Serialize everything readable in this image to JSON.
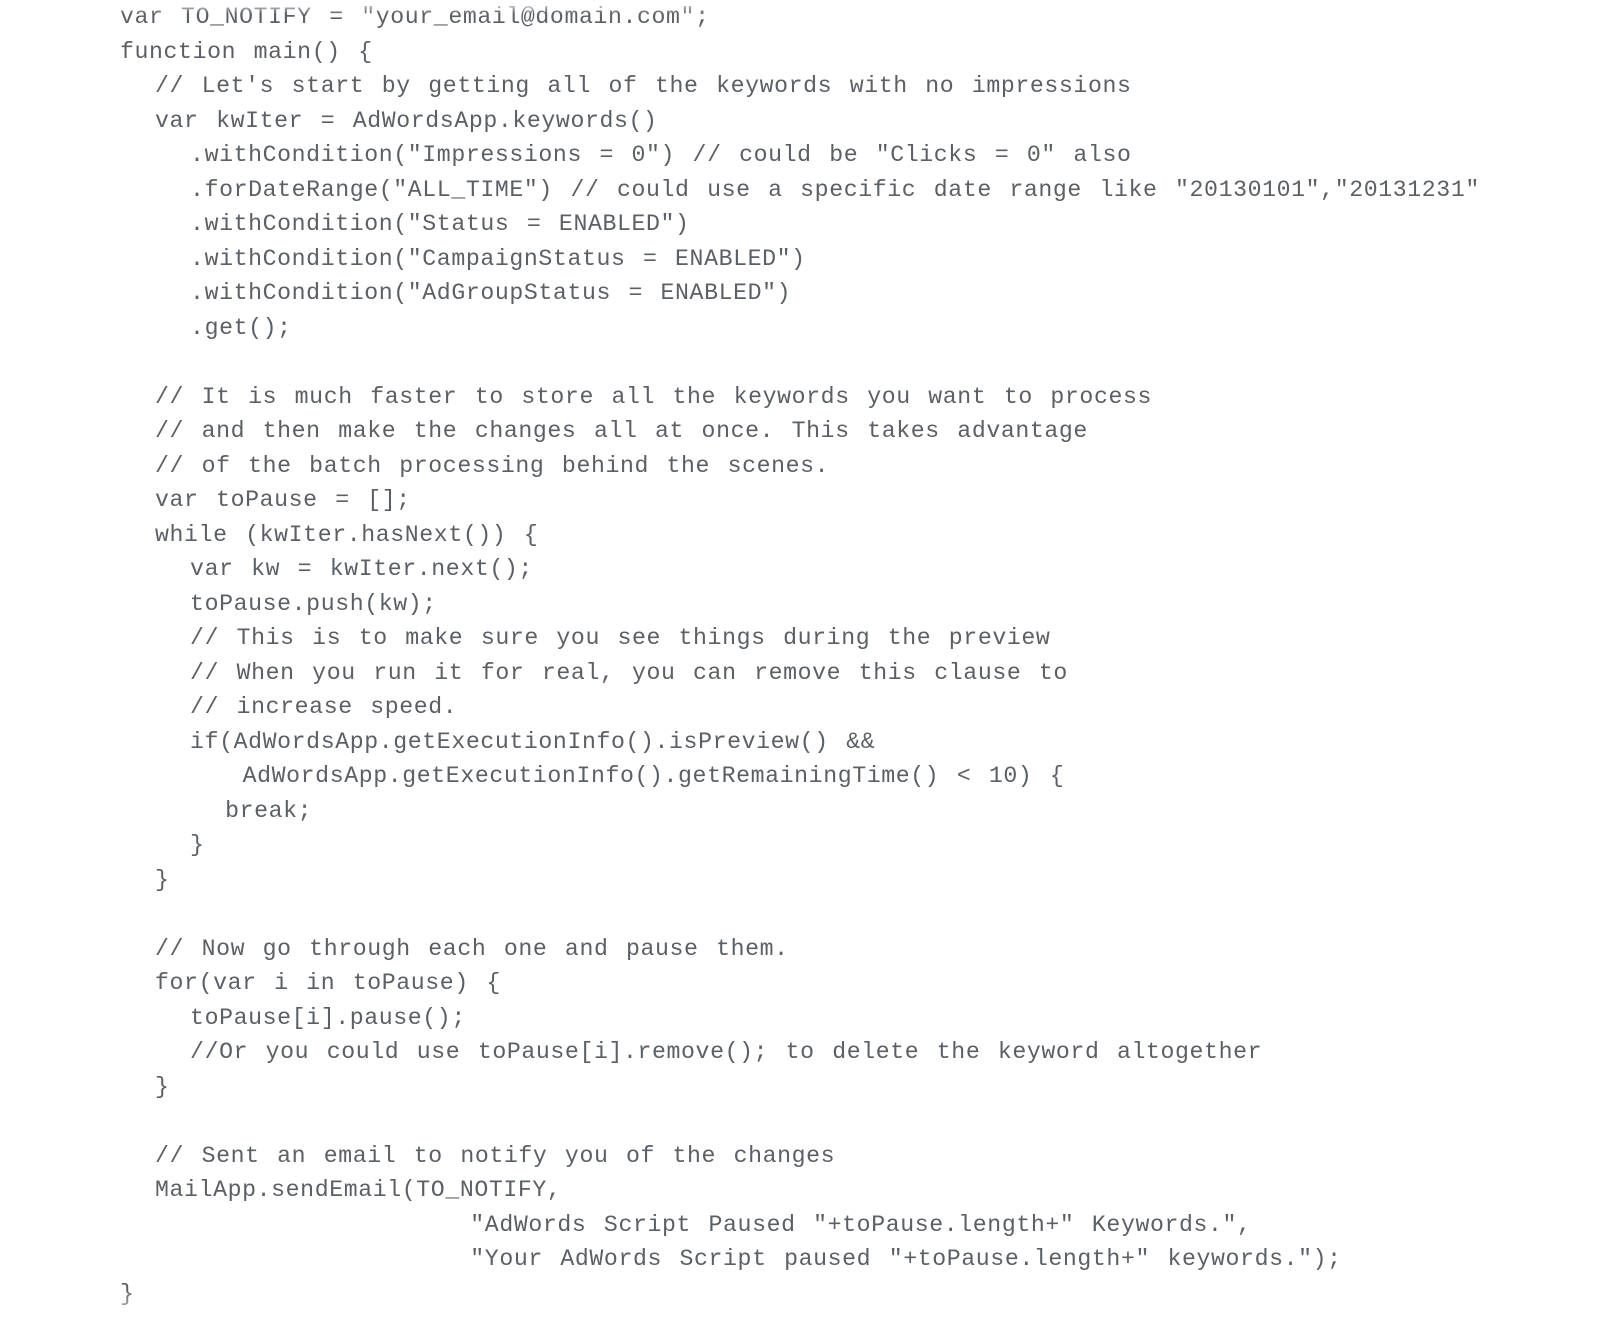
{
  "code": {
    "lines": [
      "var TO_NOTIFY = \"your_email@domain.com\";",
      "function main() {",
      "  // Let's start by getting all of the keywords with no impressions",
      "  var kwIter = AdWordsApp.keywords()",
      "    .withCondition(\"Impressions = 0\") // could be \"Clicks = 0\" also",
      "    .forDateRange(\"ALL_TIME\") // could use a specific date range like \"20130101\",\"20131231\"",
      "    .withCondition(\"Status = ENABLED\")",
      "    .withCondition(\"CampaignStatus = ENABLED\")",
      "    .withCondition(\"AdGroupStatus = ENABLED\")",
      "    .get();",
      " ",
      "  // It is much faster to store all the keywords you want to process",
      "  // and then make the changes all at once. This takes advantage",
      "  // of the batch processing behind the scenes.",
      "  var toPause = [];",
      "  while (kwIter.hasNext()) {",
      "    var kw = kwIter.next();",
      "    toPause.push(kw);",
      "    // This is to make sure you see things during the preview",
      "    // When you run it for real, you can remove this clause to",
      "    // increase speed.",
      "    if(AdWordsApp.getExecutionInfo().isPreview() &&",
      "       AdWordsApp.getExecutionInfo().getRemainingTime() < 10) {",
      "      break;",
      "    }",
      "  }",
      " ",
      "  // Now go through each one and pause them.",
      "  for(var i in toPause) {",
      "    toPause[i].pause();",
      "    //Or you could use toPause[i].remove(); to delete the keyword altogether",
      "  }",
      " ",
      "  // Sent an email to notify you of the changes",
      "  MailApp.sendEmail(TO_NOTIFY,",
      "                    \"AdWords Script Paused \"+toPause.length+\" Keywords.\",",
      "                    \"Your AdWords Script paused \"+toPause.length+\" keywords.\");",
      "}"
    ]
  }
}
